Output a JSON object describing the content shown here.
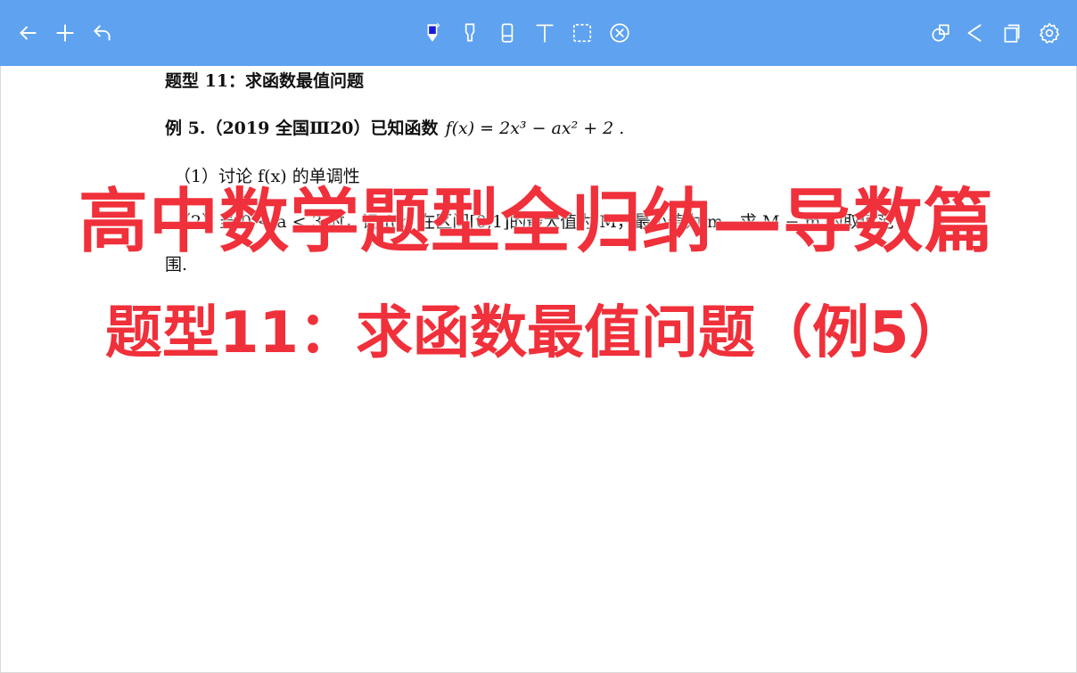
{
  "toolbar": {
    "left_icons": [
      "back-arrow-icon",
      "plus-icon",
      "undo-icon"
    ],
    "center_icons": [
      "pen-icon",
      "highlighter-icon",
      "eraser-icon",
      "text-tool-icon",
      "lasso-select-icon",
      "clear-icon"
    ],
    "right_icons": [
      "shapes-icon",
      "share-icon",
      "pages-icon",
      "settings-icon"
    ],
    "accent_color": "#5ea2f0",
    "active_pen_color": "#1a1adf"
  },
  "document": {
    "heading": "题型 11：求函数最值问题",
    "example_label": "例 5.（2019 全国Ⅲ20）已知函数",
    "example_formula": "f(x) = 2x³ − ax² + 2 .",
    "part1": "（1）讨论 f(x) 的单调性",
    "part2": "（2）当 0 < a < 3 时，记 f(x) 在区间[0,1]的最大值为 M，最小值为 m，求 M − m 的取值范",
    "part2_end": "围."
  },
  "overlay": {
    "title": "高中数学题型全归纳—导数篇",
    "subtitle": "题型11：求函数最值问题（例5）",
    "color": "#f0303a"
  }
}
